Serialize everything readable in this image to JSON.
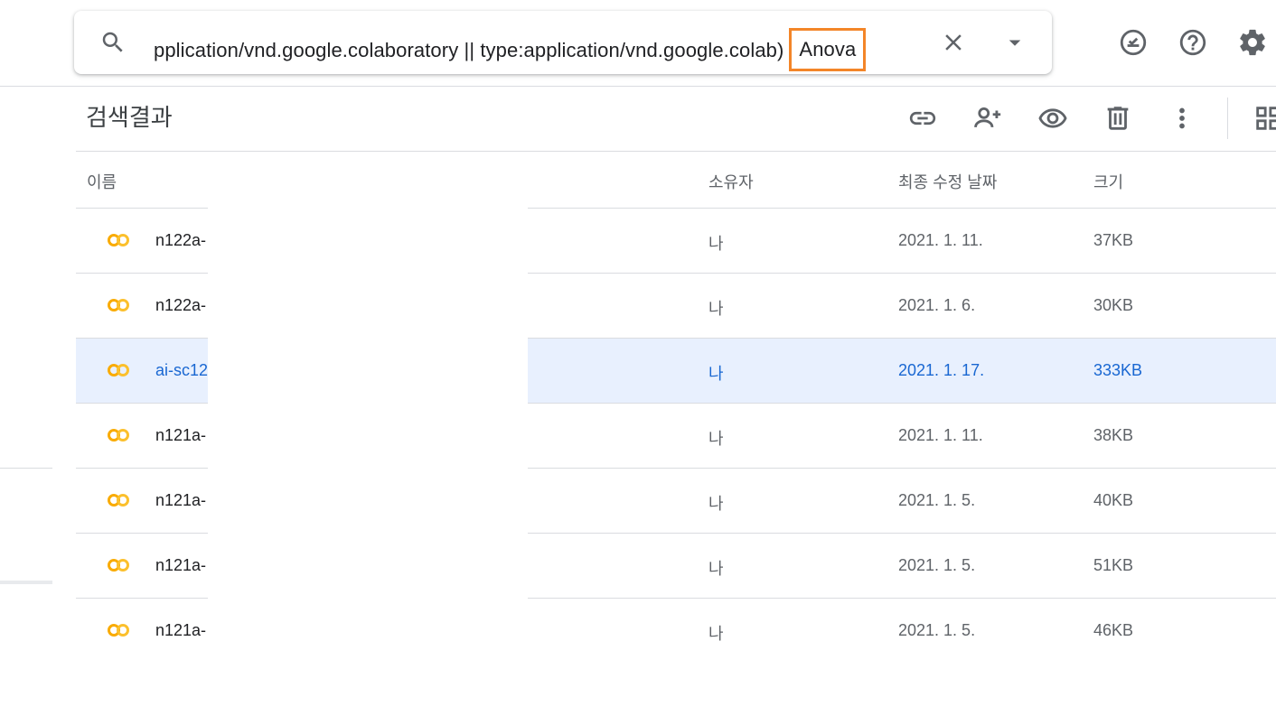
{
  "search": {
    "query": "pplication/vnd.google.colaboratory || type:application/vnd.google.colab)",
    "highlight": "Anova",
    "icons": {
      "search": "search-icon",
      "clear": "close-icon",
      "dropdown": "caret-down-icon"
    }
  },
  "top_icons": [
    "offline-check-icon",
    "help-icon",
    "gear-icon"
  ],
  "toolbar": {
    "title": "검색결과",
    "icons": [
      "link-icon",
      "add-person-icon",
      "preview-eye-icon",
      "trash-icon",
      "more-vert-icon",
      "grid-view-icon"
    ]
  },
  "table": {
    "headers": {
      "name": "이름",
      "owner": "소유자",
      "modified": "최종 수정 날짜",
      "size": "크기"
    },
    "rows": [
      {
        "name": "n122a-",
        "owner": "나",
        "modified": "2021. 1. 11.",
        "size": "37KB"
      },
      {
        "name": "n122a-",
        "owner": "나",
        "modified": "2021. 1. 6.",
        "size": "30KB"
      },
      {
        "name": "ai-sc12",
        "owner": "나",
        "modified": "2021. 1. 17.",
        "size": "333KB"
      },
      {
        "name": "n121a-",
        "owner": "나",
        "modified": "2021. 1. 11.",
        "size": "38KB"
      },
      {
        "name": "n121a-",
        "owner": "나",
        "modified": "2021. 1. 5.",
        "size": "40KB"
      },
      {
        "name": "n121a-",
        "owner": "나",
        "modified": "2021. 1. 5.",
        "size": "51KB"
      },
      {
        "name": "n121a-",
        "owner": "나",
        "modified": "2021. 1. 5.",
        "size": "46KB"
      }
    ],
    "selected_row": 2
  },
  "colors": {
    "highlight_border": "#f38528",
    "selected_bg": "#e8f0fe",
    "selected_text": "#1967d2",
    "colab_icon": "#f9ab00"
  }
}
